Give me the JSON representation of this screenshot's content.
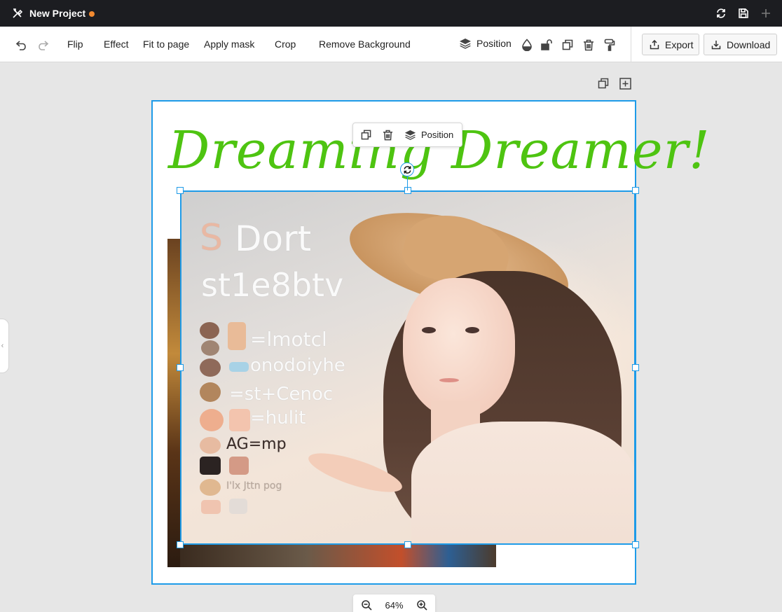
{
  "app": {
    "project_title": "New Project",
    "unsaved_dot_color": "#f28a30",
    "titlebar_icons": [
      "tools-icon",
      "sync-icon",
      "save-icon",
      "plus-icon"
    ]
  },
  "toolbar": {
    "undo_icon": "undo-icon",
    "redo_icon": "redo-icon",
    "actions": {
      "flip": "Flip",
      "effect": "Effect",
      "fit_to_page": "Fit to page",
      "apply_mask": "Apply mask",
      "crop": "Crop",
      "remove_background": "Remove Background"
    },
    "position_label": "Position",
    "right_icons": [
      "layers-icon",
      "opacity-icon",
      "unlock-icon",
      "duplicate-icon",
      "delete-icon",
      "paint-roller-icon"
    ],
    "export_label": "Export",
    "download_label": "Download"
  },
  "canvas": {
    "headline": "Dreaming Dreamer!",
    "headline_color": "#4ec411",
    "selection_color": "#1e9be8",
    "page_tools": [
      "duplicate-page-icon",
      "add-page-icon"
    ],
    "image_text": {
      "line1": "Dort",
      "line2": "st1e8btv",
      "row1": "=lmotcl",
      "row2": "onodoiyhe",
      "row3": "=st+Cenoc",
      "row4": "=hulit",
      "row5": "AG=mp",
      "row6": "I'lx Jttn pog"
    }
  },
  "floating_toolbar": {
    "position_label": "Position"
  },
  "zoom": {
    "value": "64%"
  }
}
